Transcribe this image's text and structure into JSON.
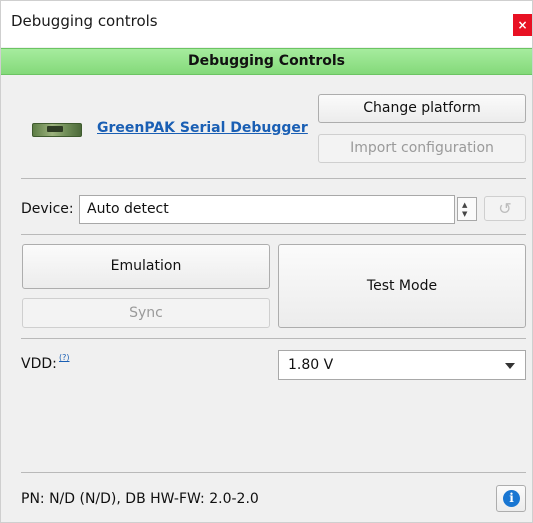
{
  "window": {
    "title": "Debugging controls",
    "close_glyph": "×"
  },
  "banner": {
    "title": "Debugging Controls"
  },
  "platform": {
    "link_label": "GreenPAK Serial Debugger",
    "change_button": "Change platform",
    "import_button": "Import configuration"
  },
  "device": {
    "label": "Device:",
    "value": "Auto detect",
    "spin_up": "▲",
    "spin_down": "▼",
    "reset_glyph": "↺"
  },
  "modes": {
    "emulation_button": "Emulation",
    "sync_button": "Sync",
    "test_mode_button": "Test Mode"
  },
  "vdd": {
    "label": "VDD:",
    "help_marker": "(?)",
    "selected": "1.80 V"
  },
  "status": {
    "text": "PN: N/D (N/D), DB HW-FW: 2.0-2.0",
    "info_glyph": "i"
  },
  "colors": {
    "banner": "#8fe087",
    "link": "#1a5fb4",
    "close": "#e81123",
    "info": "#1976d2"
  },
  "icons": [
    "close-icon",
    "board-icon",
    "spin-up-icon",
    "spin-down-icon",
    "undo-icon",
    "chevron-down-icon",
    "info-icon"
  ]
}
